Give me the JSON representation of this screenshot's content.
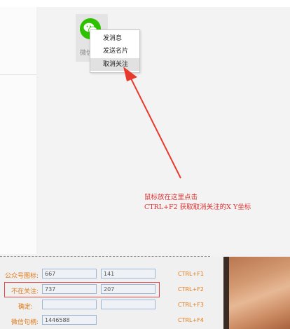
{
  "wechat": {
    "label": "微信",
    "brand_color": "#2dc100",
    "icon": "wechat-icon"
  },
  "context_menu": {
    "items": [
      {
        "label": "发消息"
      },
      {
        "label": "发送名片"
      },
      {
        "label": "取消关注",
        "highlighted": true
      }
    ]
  },
  "annotation": {
    "line1": "鼠标放在这里点击",
    "line2": "CTRL+F2 获取取消关注的X Y坐标",
    "color": "#e03030"
  },
  "form": {
    "rows": [
      {
        "label": "公众号图标:",
        "x": "667",
        "y": "141",
        "hotkey": "CTRL+F1"
      },
      {
        "label": "不在关注:",
        "x": "737",
        "y": "207",
        "hotkey": "CTRL+F2",
        "highlighted": true
      },
      {
        "label": "确定:",
        "x": "",
        "y": "",
        "hotkey": "CTRL+F3"
      },
      {
        "label": "微信句柄:",
        "x": "1446588",
        "y": "",
        "hotkey": "CTRL+F4"
      }
    ]
  }
}
